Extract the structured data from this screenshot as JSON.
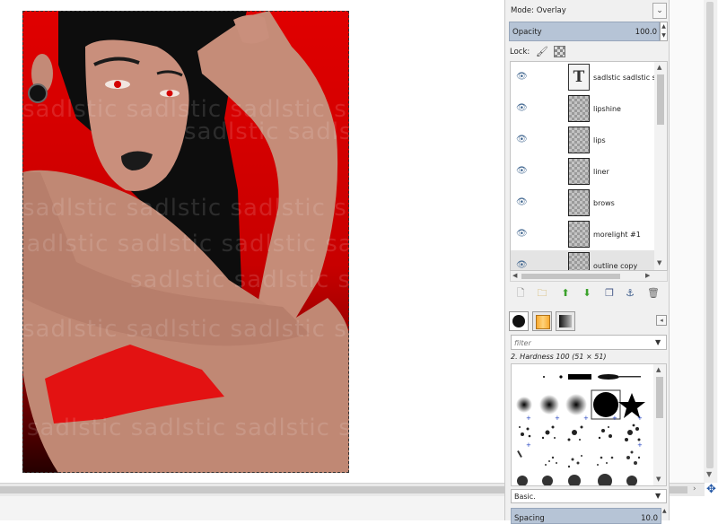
{
  "canvas": {
    "watermark": "sadlstic"
  },
  "layers_panel": {
    "mode_label": "Mode: Overlay",
    "opacity_label": "Opacity",
    "opacity_value": "100.0",
    "lock_label": "Lock:",
    "layers": [
      {
        "name": "sadlstic sadlstic sa",
        "type": "text"
      },
      {
        "name": "lipshine",
        "type": "raster"
      },
      {
        "name": "lips",
        "type": "raster"
      },
      {
        "name": "liner",
        "type": "raster"
      },
      {
        "name": "brows",
        "type": "raster"
      },
      {
        "name": "morelight #1",
        "type": "raster"
      },
      {
        "name": "outline copy",
        "type": "raster"
      }
    ],
    "text_thumb_glyph": "T"
  },
  "brushes_panel": {
    "filter_placeholder": "filter",
    "brush_name": "2. Hardness 100 (51 × 51)",
    "preset_label": "Basic.",
    "spacing_label": "Spacing",
    "spacing_value": "10.0"
  },
  "colors": {
    "accent_bar": "#b6c4d6",
    "canvas_red": "#e00000"
  }
}
